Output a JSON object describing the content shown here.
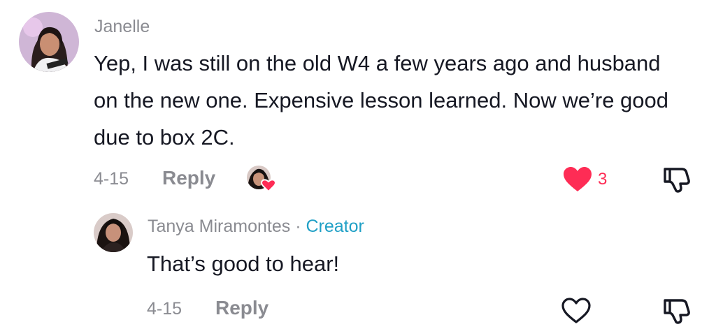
{
  "comments": [
    {
      "username": "Janelle",
      "text": "Yep, I was still on the old W4 a few years ago and husband on the new one. Expensive lesson learned. Now we’re good due to box 2C.",
      "date": "4-15",
      "reply_label": "Reply",
      "like_count": "3",
      "liked": true,
      "creator_liked": true
    },
    {
      "username": "Tanya Miramontes",
      "separator": "·",
      "badge": "Creator",
      "text": "That’s good to hear!",
      "date": "4-15",
      "reply_label": "Reply",
      "liked": false
    }
  ],
  "colors": {
    "like_active": "#fe2c55",
    "muted": "#8a8b91",
    "creator_badge": "#20a0c6",
    "text": "#161823"
  },
  "icons": {
    "like_filled": "heart-filled-icon",
    "like_outline": "heart-outline-icon",
    "dislike": "thumbs-down-icon"
  }
}
